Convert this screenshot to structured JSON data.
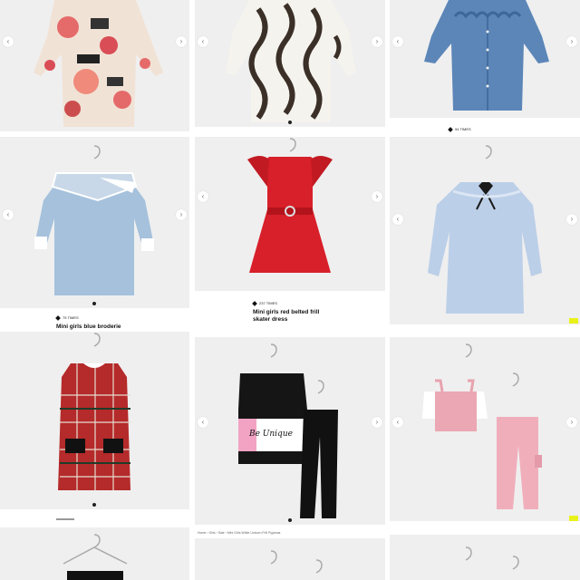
{
  "grid": {
    "arrow_left": "‹",
    "arrow_right": "›"
  },
  "tiles": {
    "t1": {
      "name": "floral print shirt dress"
    },
    "t2": {
      "name": "swirl print dress"
    },
    "t3": {
      "name": "denim frill dress",
      "times": "94 TIMES"
    },
    "t4": {
      "name": "mini girls blue broderie dress",
      "times": "75 TIMES",
      "title": "Mini girls blue broderie"
    },
    "t5": {
      "name": "mini girls red belted frill skater dress",
      "times": "237 TIMES",
      "title": "Mini girls red belted frill skater dress"
    },
    "t6": {
      "name": "blue lace dress with bow"
    },
    "t7": {
      "name": "red tartan pinafore dress"
    },
    "t8": {
      "name": "be unique outfit set",
      "logo_text": "Be Unique"
    },
    "t9": {
      "name": "pink cargo outfit set"
    },
    "t11": {
      "breadcrumb": "Home › Girls › Sale › Mini Girls White Unicorn Frill Pyjamas"
    }
  },
  "colors": {
    "badge": "#e8f21a",
    "tile_bg": "#efefef"
  }
}
